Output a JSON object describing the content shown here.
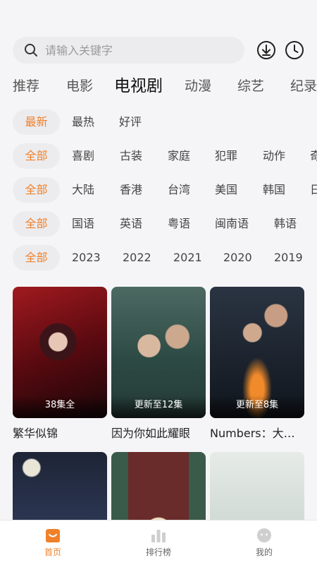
{
  "search": {
    "placeholder": "请输入关键字"
  },
  "categories": [
    "推荐",
    "电影",
    "电视剧",
    "动漫",
    "综艺",
    "纪录"
  ],
  "active_category": "电视剧",
  "filters": {
    "sort": [
      "最新",
      "最热",
      "好评"
    ],
    "genre": [
      "全部",
      "喜剧",
      "古装",
      "家庭",
      "犯罪",
      "动作",
      "奇"
    ],
    "region": [
      "全部",
      "大陆",
      "香港",
      "台湾",
      "美国",
      "韩国",
      "日"
    ],
    "language": [
      "全部",
      "国语",
      "英语",
      "粤语",
      "闽南语",
      "韩语"
    ],
    "year": [
      "全部",
      "2023",
      "2022",
      "2021",
      "2020",
      "2019"
    ]
  },
  "cards": [
    {
      "title": "繁华似锦",
      "badge": "38集全"
    },
    {
      "title": "因为你如此耀眼",
      "badge": "更新至12集"
    },
    {
      "title": "Numbers：大厦森林的监视者们",
      "badge": "更新至8集"
    },
    {
      "title": "",
      "badge": ""
    },
    {
      "title": "",
      "badge": ""
    },
    {
      "title": "",
      "badge": ""
    }
  ],
  "bottom_nav": [
    {
      "label": "首页",
      "icon": "home-icon",
      "active": true
    },
    {
      "label": "排行榜",
      "icon": "ranking-icon",
      "active": false
    },
    {
      "label": "我的",
      "icon": "profile-icon",
      "active": false
    }
  ],
  "colors": {
    "accent": "#f0812a",
    "chip_bg": "#ececef",
    "page_bg": "#f5f5f7"
  }
}
